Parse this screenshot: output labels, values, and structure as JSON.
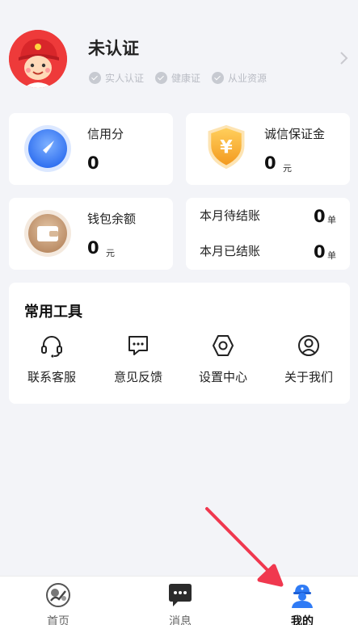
{
  "profile": {
    "name": "未认证",
    "tags": [
      "实人认证",
      "健康证",
      "从业资源"
    ]
  },
  "cards": {
    "credit": {
      "title": "信用分",
      "value": "0"
    },
    "deposit": {
      "title": "诚信保证金",
      "value": "0",
      "unit": "元"
    },
    "wallet": {
      "title": "钱包余额",
      "value": "0",
      "unit": "元"
    },
    "settle": {
      "pending_label": "本月待结账",
      "pending_value": "0",
      "pending_unit": "单",
      "done_label": "本月已结账",
      "done_value": "0",
      "done_unit": "单"
    }
  },
  "tools": {
    "title": "常用工具",
    "items": [
      {
        "label": "联系客服",
        "icon": "headset-icon"
      },
      {
        "label": "意见反馈",
        "icon": "feedback-icon"
      },
      {
        "label": "设置中心",
        "icon": "settings-icon"
      },
      {
        "label": "关于我们",
        "icon": "user-circle-icon"
      }
    ]
  },
  "tabbar": {
    "items": [
      {
        "label": "首页",
        "icon": "home-icon"
      },
      {
        "label": "消息",
        "icon": "message-icon"
      },
      {
        "label": "我的",
        "icon": "profile-icon"
      }
    ],
    "active_index": 2
  },
  "colors": {
    "background": "#f3f4f8",
    "accent_blue": "#2f7bf5",
    "annotation_arrow": "#f0384f"
  }
}
